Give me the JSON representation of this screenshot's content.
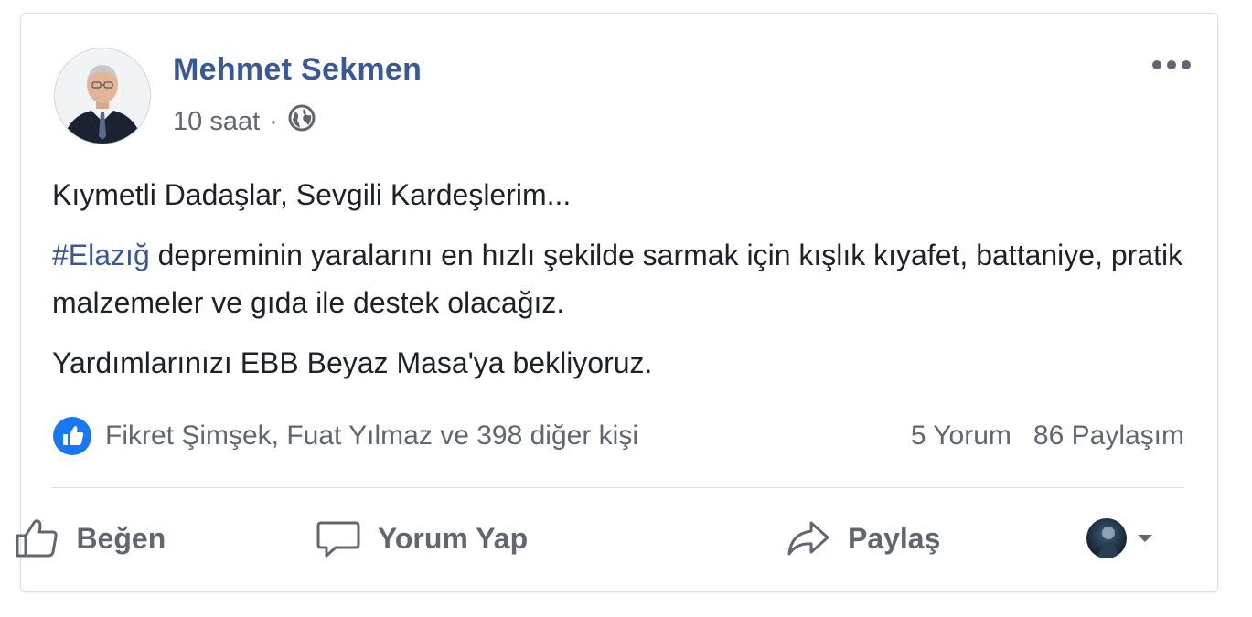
{
  "post": {
    "author": "Mehmet Sekmen",
    "time": "10 saat",
    "separator": "·",
    "privacy_icon": "globe-icon",
    "menu_icon": "more-options-icon",
    "avatar_icon": "profile-photo",
    "paragraphs": {
      "p1": "Kıymetli Dadaşlar, Sevgili Kardeşlerim...",
      "p2_hashtag": "#Elazığ",
      "p2_rest": " depreminin yaralarını en hızlı şekilde sarmak için kışlık kıyafet, battaniye, pratik malzemeler ve gıda ile destek olacağız.",
      "p3": "Yardımlarınızı EBB Beyaz Masa'ya bekliyoruz."
    },
    "reactions": {
      "icon": "like-reaction-icon",
      "text": "Fikret Şimşek, Fuat Yılmaz ve 398 diğer kişi"
    },
    "counts": {
      "comments": "5 Yorum",
      "shares": "86 Paylaşım"
    },
    "actions": {
      "like": "Beğen",
      "comment": "Yorum Yap",
      "share": "Paylaş"
    }
  },
  "colors": {
    "link": "#385898",
    "text": "#1d2129",
    "muted": "#606770",
    "like_blue": "#1877f2"
  }
}
